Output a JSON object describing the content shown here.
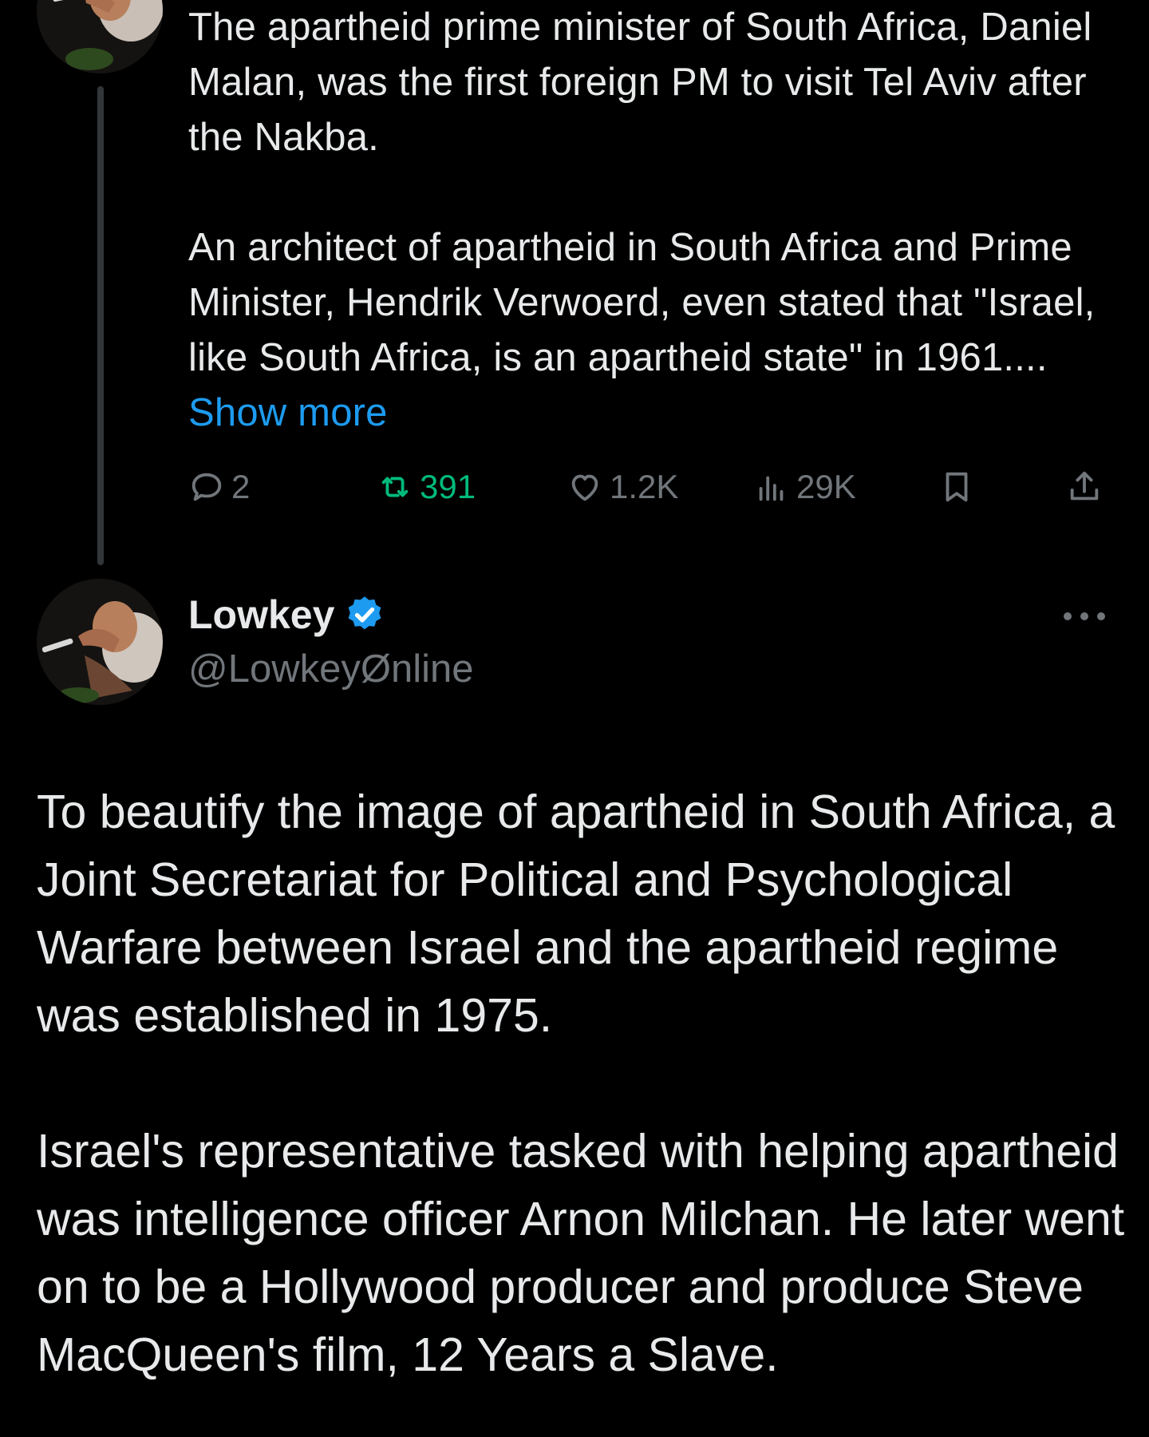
{
  "tweet1": {
    "paragraph1": "The apartheid prime minister of South Africa, Daniel Malan, was the first foreign PM to visit Tel Aviv after the Nakba.",
    "paragraph2": "An architect of apartheid in South Africa and Prime Minister, Hendrik Verwoerd, even stated that \"Israel, like South Africa, is an apartheid state\" in 1961....",
    "show_more": "Show more",
    "actions": {
      "replies": "2",
      "reposts": "391",
      "likes": "1.2K",
      "views": "29K"
    },
    "icons": [
      "reply-icon",
      "repost-icon",
      "like-icon",
      "views-icon",
      "bookmark-icon",
      "share-icon"
    ]
  },
  "tweet2": {
    "display_name": "Lowkey",
    "handle": "@LowkeyØnline",
    "verified": true,
    "paragraph1": "To beautify the image of apartheid in South Africa, a Joint Secretariat for Political and Psychological Warfare between Israel and the apartheid regime was established in 1975.",
    "paragraph2": "Israel's representative tasked with helping apartheid was intelligence officer Arnon Milchan. He later went on to be a Hollywood producer and produce Steve MacQueen's film, 12 Years a Slave."
  },
  "colors": {
    "background": "#000000",
    "text": "#e7e9ea",
    "muted": "#71767b",
    "link": "#1d9bf0",
    "repost_active": "#00ba7c",
    "verified": "#1d9bf0"
  }
}
